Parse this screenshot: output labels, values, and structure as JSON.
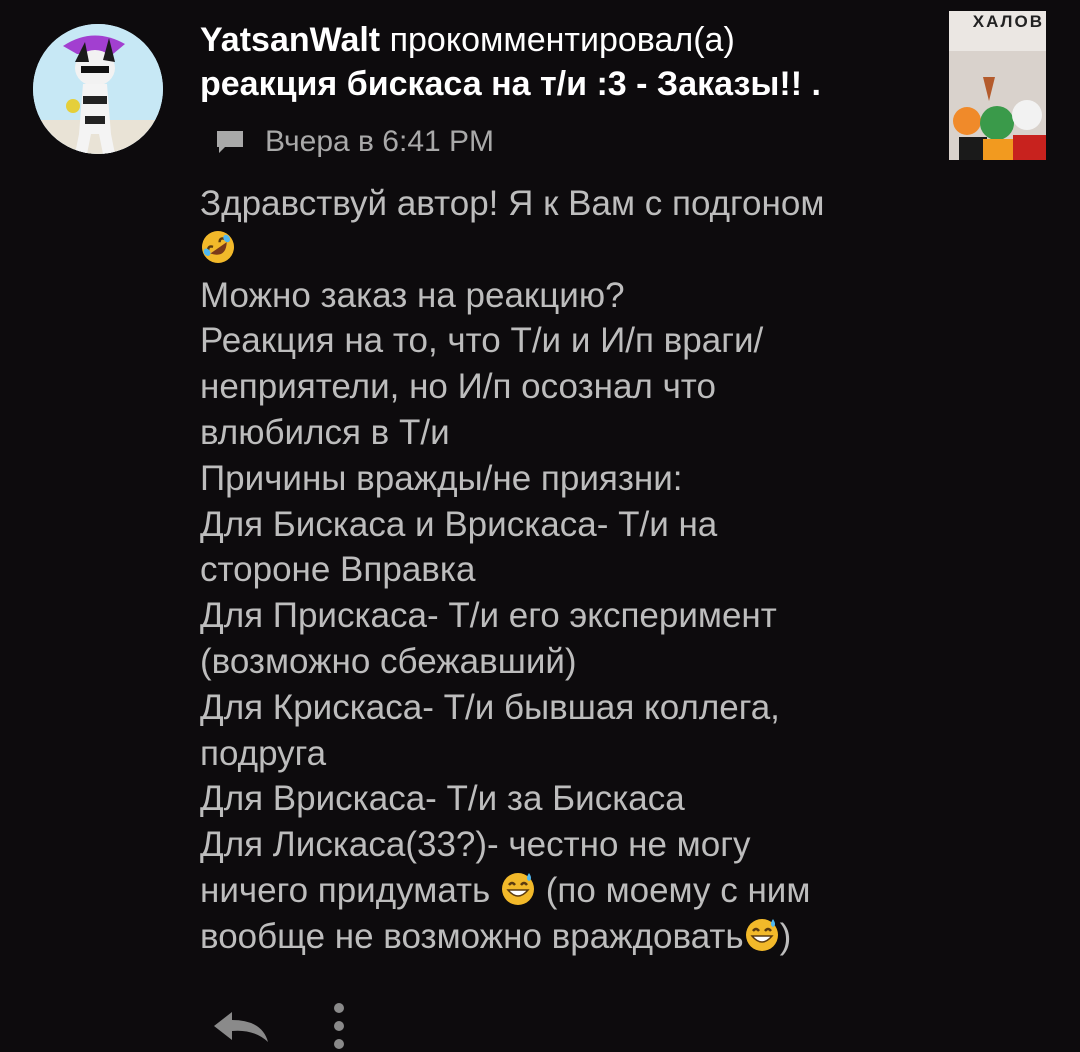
{
  "notification": {
    "user": "YatsanWalt",
    "action": "прокомментировал(а)",
    "post_title": "реакция бискаса на т/и :3 - Заказы!! .",
    "timestamp": "Вчера в 6:41 PM",
    "thumbnail_caption": "ХАЛОВ",
    "comment_lines": [
      "Здравствуй автор! Я к Вам с подгоном",
      "Можно заказ на реакцию?",
      "Реакция на то, что Т/и и И/п враги/",
      "неприятели, но И/п осознал что",
      "влюбился в Т/и",
      "Причины вражды/не приязни:",
      "Для Бискаса и Врискаса- Т/и на",
      "стороне Вправка",
      "Для Прискаса- Т/и его эксперимент",
      "(возможно сбежавший)",
      "Для Крискаса- Т/и бывшая коллега,",
      "подруга",
      "Для Врискаса- Т/и за Бискаса",
      "Для Лискаса(33?)- честно не могу",
      "ничего придумать",
      "(по моему с ним",
      "вообще не возможно враждовать",
      ")"
    ]
  },
  "icons": {
    "comment": "chat-bubble-icon",
    "reply": "reply-arrow-icon",
    "more": "more-vertical-icon",
    "emoji_laugh": "rolling-laughing-emoji",
    "emoji_sweat": "grinning-sweat-emoji"
  }
}
